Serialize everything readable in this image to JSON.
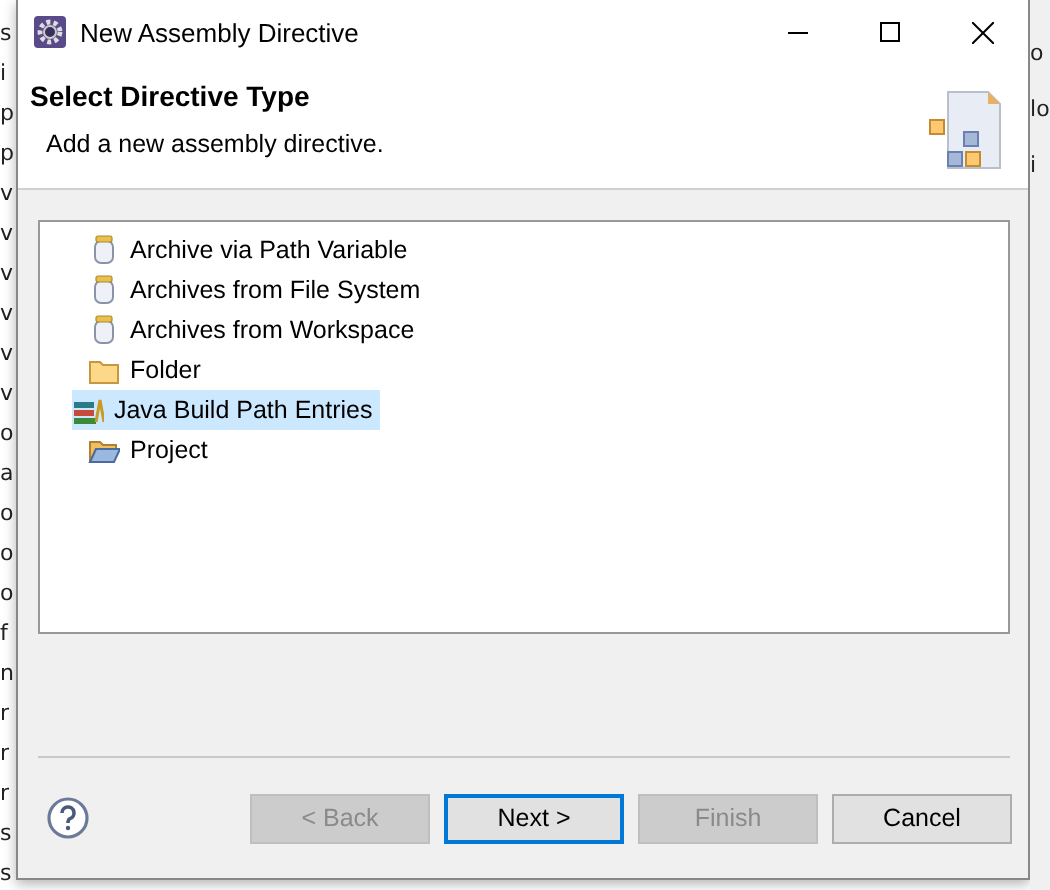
{
  "background_window": {
    "left_fragments": [
      "s",
      "i",
      "p",
      "p",
      "v",
      "v",
      "v",
      "v",
      "v",
      "v",
      "o",
      "a",
      "o",
      "o",
      "o",
      "f",
      "n",
      "r",
      "r",
      "r",
      "s",
      "s"
    ],
    "right_fragments": [
      "o",
      "lo",
      "i"
    ]
  },
  "window": {
    "title": "New Assembly Directive"
  },
  "header": {
    "title": "Select Directive Type",
    "description": "Add a new assembly directive."
  },
  "directive_types": [
    {
      "label": "Archive via Path Variable",
      "kind": "jar",
      "selected": false
    },
    {
      "label": "Archives from File System",
      "kind": "jar",
      "selected": false
    },
    {
      "label": "Archives from Workspace",
      "kind": "jar",
      "selected": false
    },
    {
      "label": "Folder",
      "kind": "folder",
      "selected": false
    },
    {
      "label": "Java Build Path Entries",
      "kind": "library",
      "selected": true
    },
    {
      "label": "Project",
      "kind": "project",
      "selected": false
    }
  ],
  "buttons": [
    {
      "label": "< Back",
      "disabled": true,
      "default": false
    },
    {
      "label": "Next >",
      "disabled": false,
      "default": true
    },
    {
      "label": "Finish",
      "disabled": true,
      "default": false
    },
    {
      "label": "Cancel",
      "disabled": false,
      "default": false
    }
  ]
}
